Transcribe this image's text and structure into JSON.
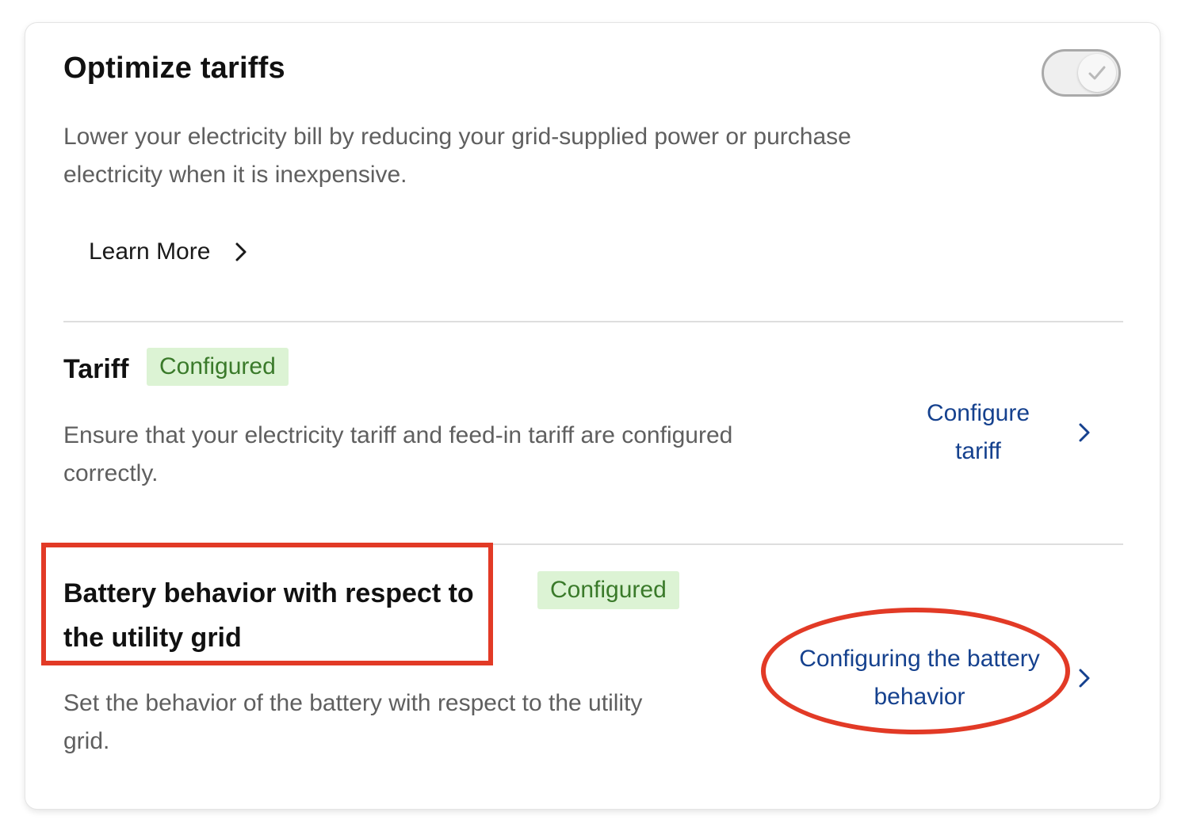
{
  "card": {
    "title": "Optimize tariffs",
    "toggle_checked": true,
    "description": "Lower your electricity bill by reducing your grid-supplied power or purchase electricity when it is inexpensive.",
    "learn_more_label": "Learn More"
  },
  "tariff": {
    "title": "Tariff",
    "status": "Configured",
    "description": "Ensure that your electricity tariff and feed-in tariff are configured correctly.",
    "link_label": "Configure tariff"
  },
  "battery": {
    "title": "Battery behavior with respect to the utility grid",
    "status": "Configured",
    "description": "Set the behavior of the battery with respect to the utility grid.",
    "link_label": "Configuring the battery behavior"
  },
  "colors": {
    "link": "#15418e",
    "badge_bg": "#dcf3d4",
    "badge_text": "#3a7a2a",
    "annotation": "#e23a26"
  },
  "icons": {
    "toggle_check": "checkmark-icon",
    "learn_more": "chevron-right-icon",
    "configure_tariff": "chevron-right-icon",
    "configure_battery": "chevron-right-icon"
  }
}
